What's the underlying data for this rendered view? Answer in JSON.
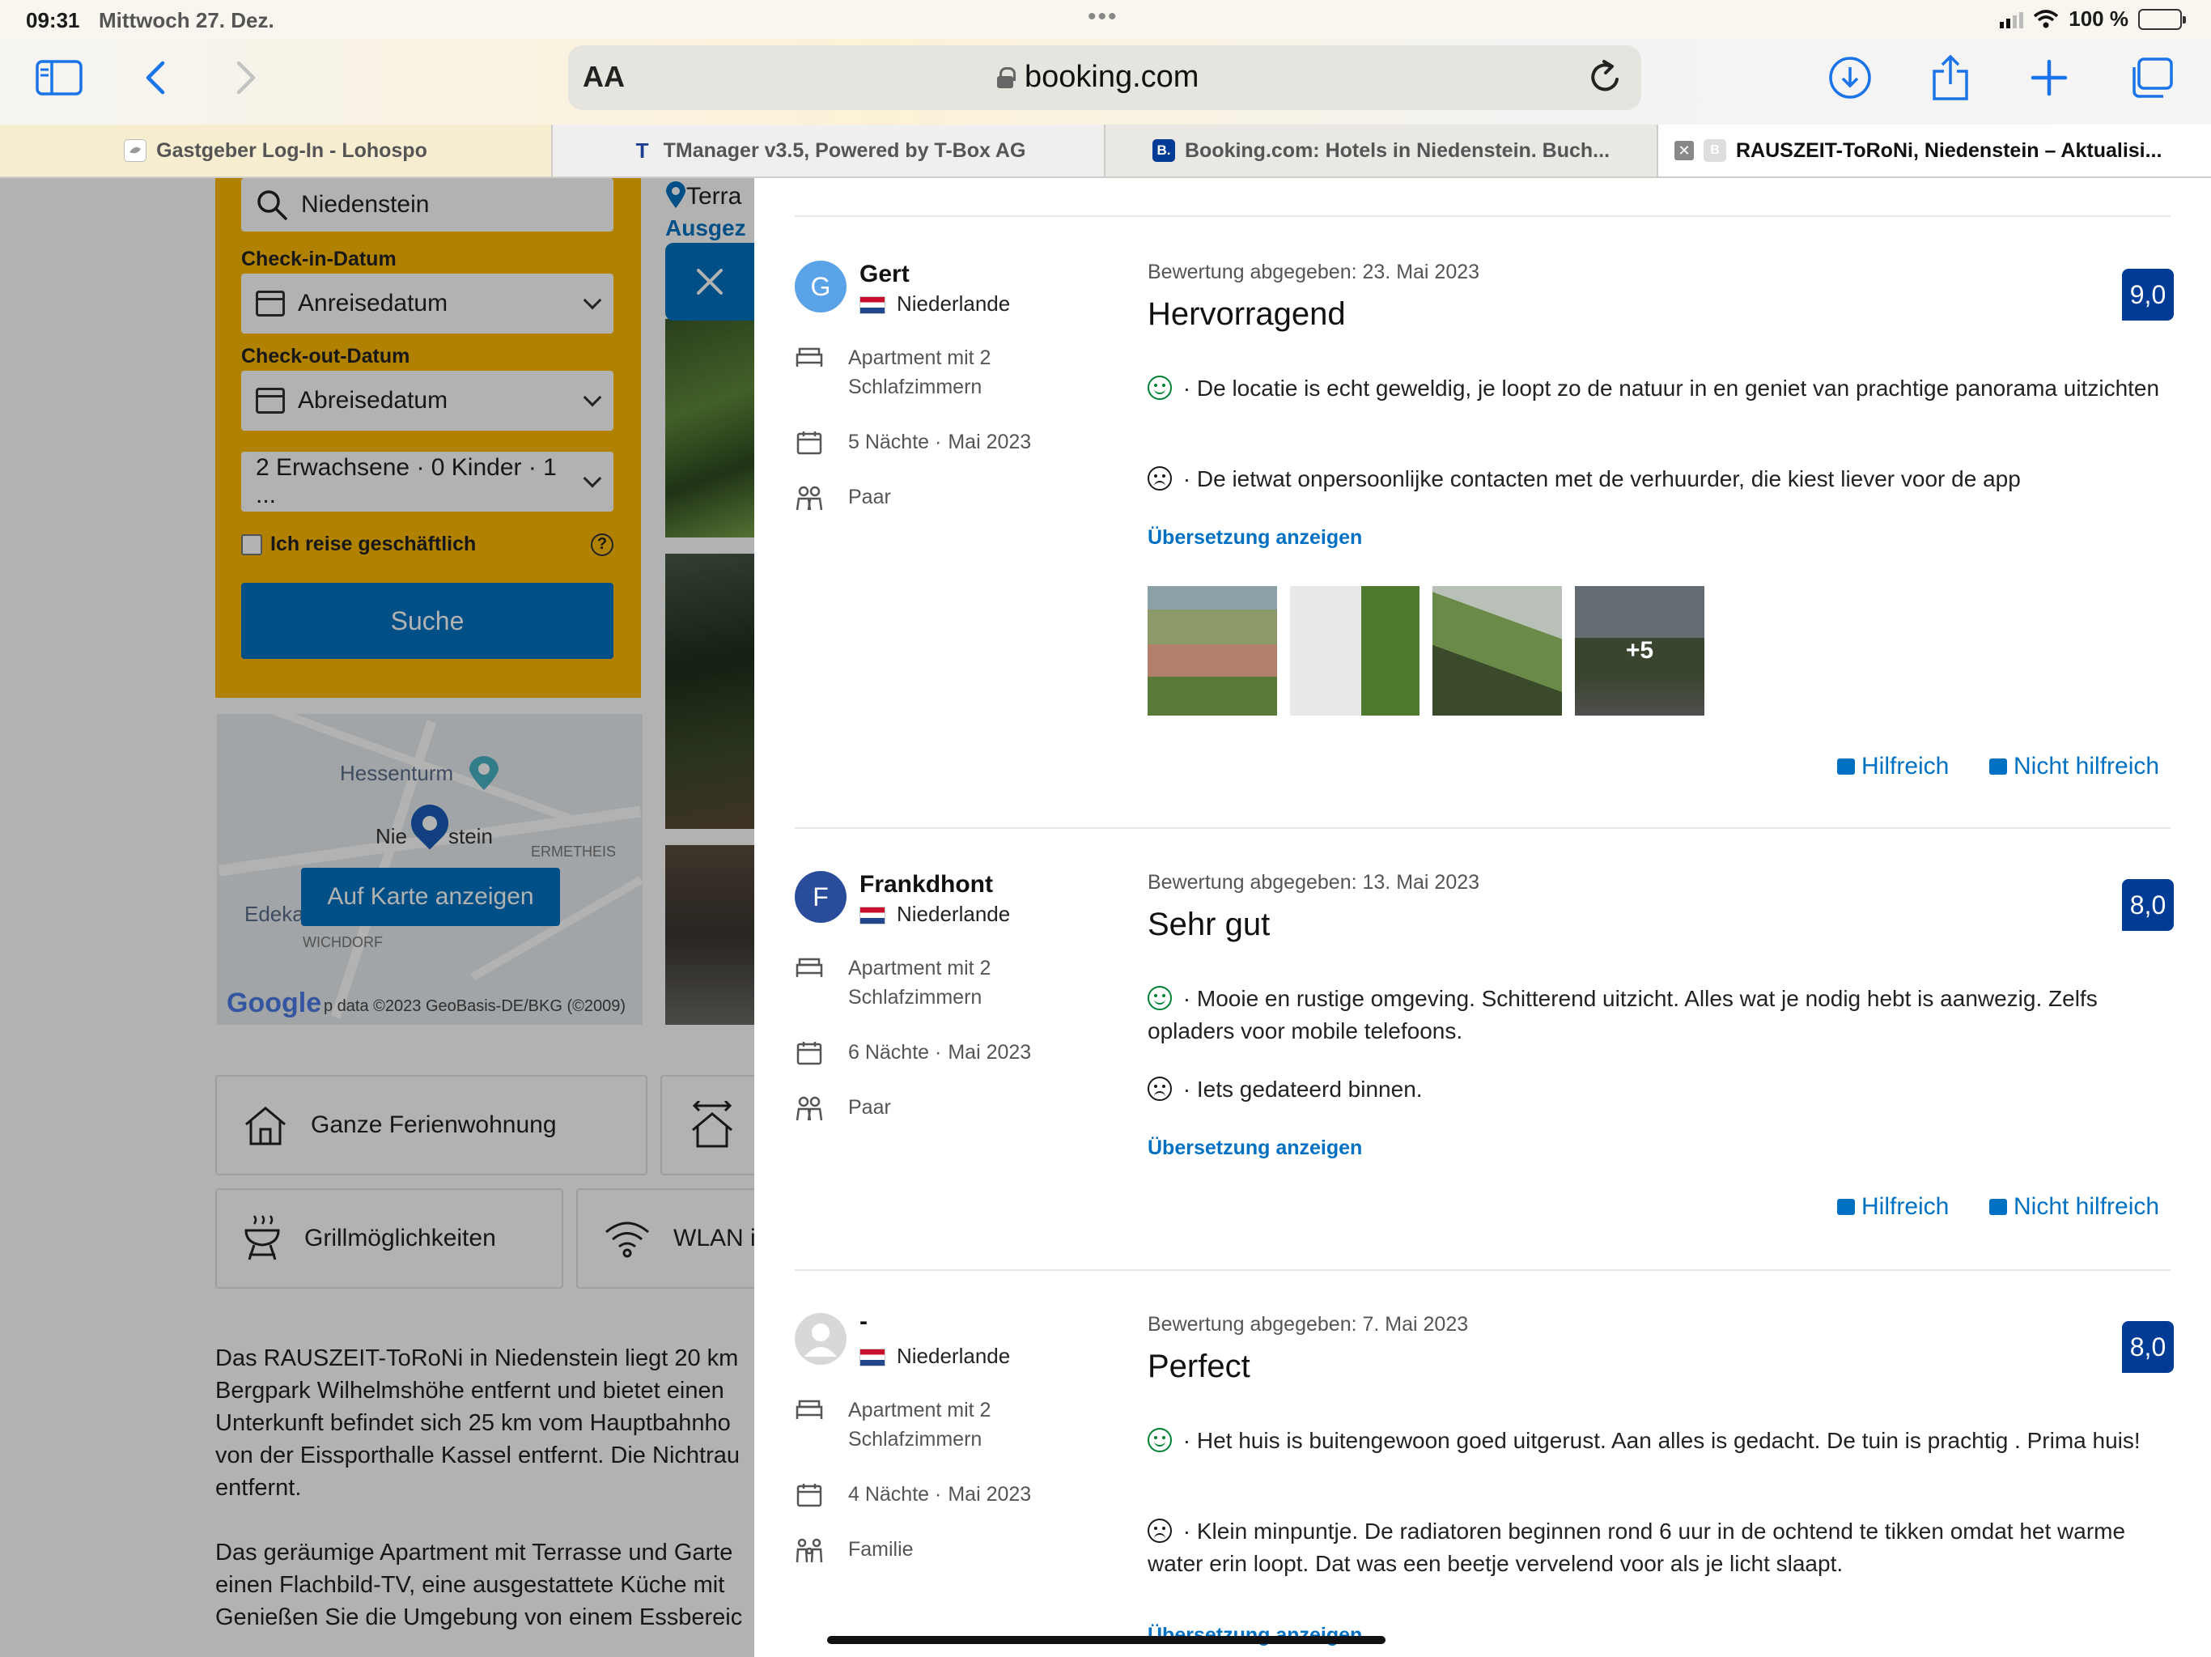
{
  "status_bar": {
    "time": "09:31",
    "date": "Mittwoch 27. Dez.",
    "battery": "100 %"
  },
  "browser": {
    "url": "booking.com",
    "aa": "AA",
    "tabs": [
      {
        "label": "Gastgeber Log-In - Lohospo",
        "icon": "lohospo-favicon"
      },
      {
        "label": "TManager v3.5, Powered by T-Box AG",
        "icon": "tbox-favicon",
        "icon_glyph": "T"
      },
      {
        "label": "Booking.com: Hotels in Niedenstein. Buch...",
        "icon": "booking-favicon",
        "icon_glyph": "B."
      },
      {
        "label": "RAUSZEIT-ToRoNi, Niedenstein – Aktualisi...",
        "icon": "booking-favicon",
        "icon_glyph": "B",
        "active": true,
        "close_glyph": "✕"
      }
    ],
    "colors": {
      "accent": "#1a73e8"
    }
  },
  "search": {
    "destination": "Niedenstein",
    "checkin_label": "Check-in-Datum",
    "checkin_placeholder": "Anreisedatum",
    "checkout_label": "Check-out-Datum",
    "checkout_placeholder": "Abreisedatum",
    "guests": "2 Erwachsene · 0 Kinder · 1 ...",
    "business_label": "Ich reise geschäftlich",
    "help_glyph": "?",
    "submit": "Suche",
    "colors": {
      "box": "#febb02",
      "button": "#0071c2"
    }
  },
  "map": {
    "labels": [
      "Hessenturm",
      "Nie",
      "stein",
      "ERMETHEIS",
      "Edeka",
      "WICHDORF"
    ],
    "show_button": "Auf Karte anzeigen",
    "google": "Google",
    "credit": "p data ©2023 GeoBasis-DE/BKG (©2009)"
  },
  "property": {
    "location_text": "Terra",
    "rating_word": "Ausgez",
    "facilities": [
      "Ganze Ferienwohnung",
      "Grillmöglichkeiten",
      "WLAN i"
    ],
    "description": [
      "Das RAUSZEIT-ToRoNi in Niedenstein liegt 20 km",
      "Bergpark Wilhelmshöhe entfernt und bietet einen",
      "Unterkunft befindet sich 25 km vom Hauptbahnho",
      "von der Eissporthalle Kassel entfernt. Die Nichtrau",
      "entfernt.",
      "Das geräumige Apartment mit Terrasse und Garte",
      "einen Flachbild-TV, eine ausgestattete Küche mit",
      "Genießen Sie die Umgebung von einem Essbereic"
    ]
  },
  "reviews": [
    {
      "initial": "G",
      "avatar_color": "#5ba3e8",
      "name": "Gert",
      "country": "Niederlande",
      "room": "Apartment mit 2 Schlafzimmern",
      "nights": "5 Nächte ·",
      "month": "Mai 2023",
      "traveller": "Paar",
      "date": "Bewertung abgegeben: 23. Mai 2023",
      "title": "Hervorragend",
      "score": "9,0",
      "positive": " · De locatie is echt geweldig, je loopt zo de natuur in en geniet van prachtige panorama uitzichten",
      "negative": " · De ietwat onpersoonlijke contacten met de verhuurder, die kiest liever voor de app",
      "translate": "Übersetzung anzeigen",
      "more_photos": "+5",
      "helpful": "Hilfreich",
      "not_helpful": "Nicht hilfreich"
    },
    {
      "initial": "F",
      "avatar_color": "#2a4d9b",
      "name": "Frankdhont",
      "country": "Niederlande",
      "room": "Apartment mit 2 Schlafzimmern",
      "nights": "6 Nächte ·",
      "month": "Mai 2023",
      "traveller": "Paar",
      "date": "Bewertung abgegeben: 13. Mai 2023",
      "title": "Sehr gut",
      "score": "8,0",
      "positive": " · Mooie en rustige omgeving. Schitterend uitzicht. Alles wat je nodig hebt is aanwezig. Zelfs opladers voor mobile telefoons.",
      "negative": " · Iets gedateerd binnen.",
      "translate": "Übersetzung anzeigen",
      "helpful": "Hilfreich",
      "not_helpful": "Nicht hilfreich"
    },
    {
      "initial": "",
      "avatar_color": "#cfcfcf",
      "name": "-",
      "country": "Niederlande",
      "room": "Apartment mit 2 Schlafzimmern",
      "nights": "4 Nächte ·",
      "month": "Mai 2023",
      "traveller": "Familie",
      "date": "Bewertung abgegeben: 7. Mai 2023",
      "title": "Perfect",
      "score": "8,0",
      "positive": " · Het huis is buitengewoon goed uitgerust. Aan alles is gedacht. De tuin is prachtig . Prima huis!",
      "negative": " · Klein minpuntje. De radiatoren beginnen rond 6 uur in de ochtend te tikken omdat het warme water erin loopt. Dat was een beetje vervelend voor als je licht slaapt.",
      "translate": "Übersetzung anzeigen"
    }
  ],
  "colors": {
    "score_badge": "#003b95",
    "link": "#0071c2",
    "positive": "#008234"
  }
}
